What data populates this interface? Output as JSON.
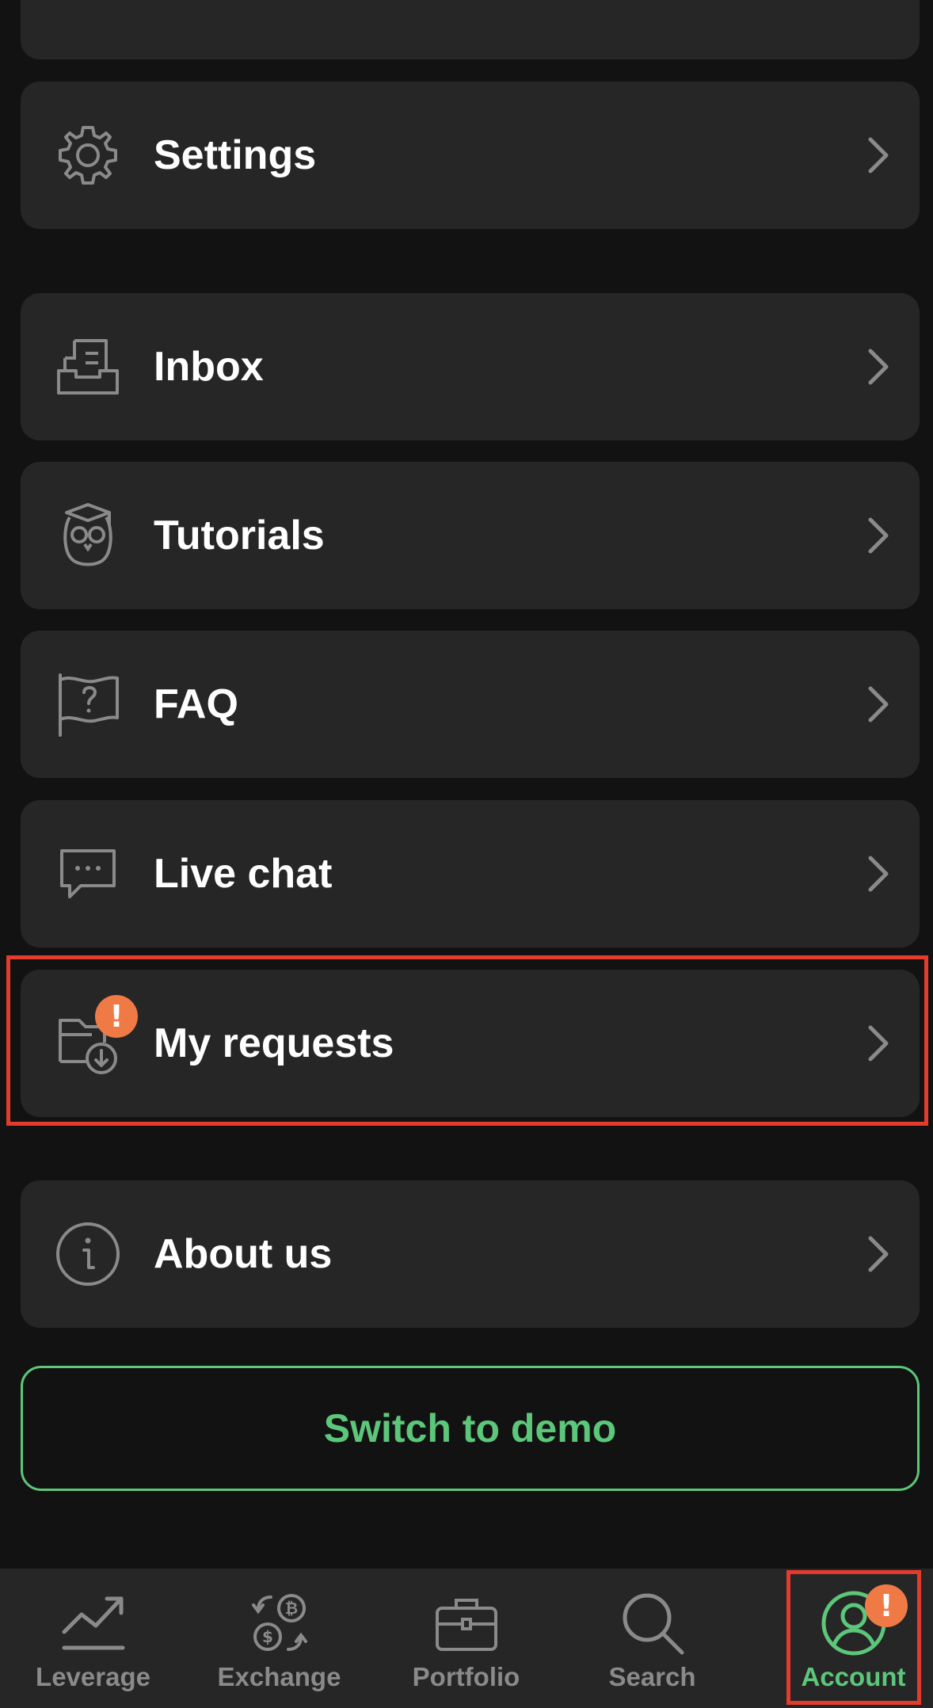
{
  "menu": {
    "settings": "Settings",
    "inbox": "Inbox",
    "tutorials": "Tutorials",
    "faq": "FAQ",
    "live_chat": "Live chat",
    "my_requests": "My requests",
    "about_us": "About us"
  },
  "badge_symbol": "!",
  "demo_button": "Switch to demo",
  "tabs": {
    "leverage": "Leverage",
    "exchange": "Exchange",
    "portfolio": "Portfolio",
    "search": "Search",
    "account": "Account"
  },
  "colors": {
    "background": "#121212",
    "card": "#262626",
    "accent_green": "#5cc77a",
    "badge_orange": "#ef7a45",
    "highlight_red": "#e53b2c",
    "inactive_gray": "#8a8a8a"
  }
}
